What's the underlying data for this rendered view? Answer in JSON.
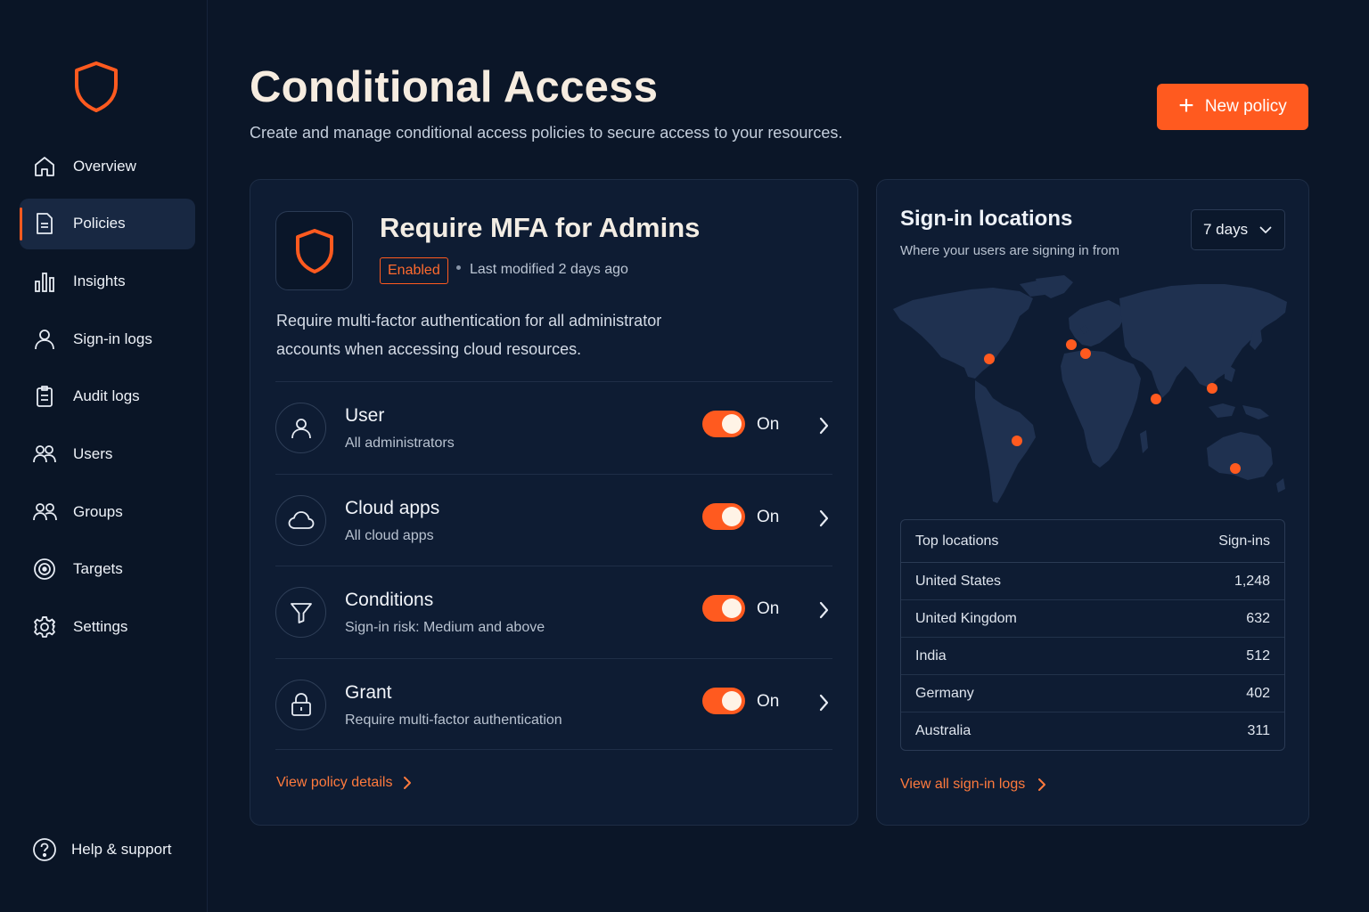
{
  "app": {
    "logo_icon": "shield-icon",
    "accent_color": "#ff5a1f",
    "background_color": "#0b1628"
  },
  "sidebar": {
    "items": [
      {
        "label": "Overview",
        "icon": "home-icon",
        "active": false
      },
      {
        "label": "Policies",
        "icon": "document-icon",
        "active": true
      },
      {
        "label": "Insights",
        "icon": "bar-chart-icon",
        "active": false
      },
      {
        "label": "Sign-in logs",
        "icon": "user-icon",
        "active": false
      },
      {
        "label": "Audit logs",
        "icon": "clipboard-icon",
        "active": false
      },
      {
        "label": "Users",
        "icon": "users-icon",
        "active": false
      },
      {
        "label": "Groups",
        "icon": "groups-icon",
        "active": false
      },
      {
        "label": "Targets",
        "icon": "target-icon",
        "active": false
      },
      {
        "label": "Settings",
        "icon": "gear-icon",
        "active": false
      }
    ],
    "help": {
      "label": "Help & support",
      "icon": "help-circle-icon"
    }
  },
  "header": {
    "title": "Conditional Access",
    "subtitle": "Create and manage conditional access policies to secure access to your resources.",
    "new_button": "New policy"
  },
  "policy": {
    "title": "Require MFA for Admins",
    "status": "Enabled",
    "modified": "Last modified 2 days ago",
    "description": "Require multi-factor authentication for all administrator accounts when accessing cloud resources.",
    "rows": [
      {
        "title": "User",
        "subtitle": "All administrators",
        "toggle": "On",
        "icon": "user-icon"
      },
      {
        "title": "Cloud apps",
        "subtitle": "All cloud apps",
        "toggle": "On",
        "icon": "cloud-icon"
      },
      {
        "title": "Conditions",
        "subtitle": "Sign-in risk: Medium and above",
        "toggle": "On",
        "icon": "filter-icon"
      },
      {
        "title": "Grant",
        "subtitle": "Require multi-factor authentication",
        "toggle": "On",
        "icon": "lock-icon"
      }
    ],
    "view_link": "View policy details"
  },
  "locations": {
    "title": "Sign-in locations",
    "subtitle": "Where your users are signing in from",
    "range": "7 days",
    "table_header": {
      "location": "Top locations",
      "count": "Sign-ins"
    },
    "rows": [
      {
        "location": "United States",
        "count": "1,248"
      },
      {
        "location": "United Kingdom",
        "count": "632"
      },
      {
        "location": "India",
        "count": "512"
      },
      {
        "location": "Germany",
        "count": "402"
      },
      {
        "location": "Australia",
        "count": "311"
      }
    ],
    "view_link": "View all sign-in logs"
  }
}
